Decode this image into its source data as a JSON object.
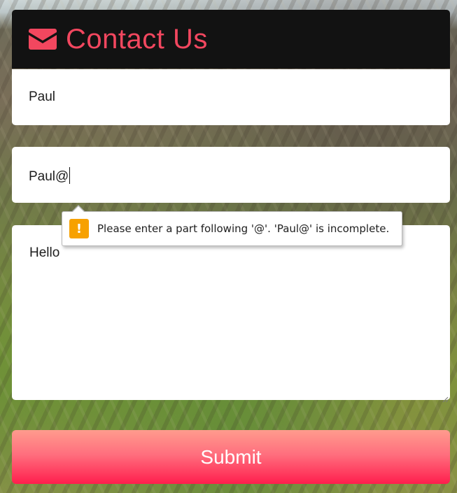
{
  "header": {
    "icon": "envelope-icon",
    "title": "Contact Us",
    "title_color": "#f2475f",
    "background": "#121212"
  },
  "form": {
    "name_value": "Paul",
    "email_value": "Paul@",
    "message_value": "Hello",
    "submit_label": "Submit"
  },
  "validation_tooltip": {
    "icon": "warning-icon",
    "icon_glyph": "!",
    "icon_color": "#f7a100",
    "message": "Please enter a part following '@'. 'Paul@' is incomplete."
  },
  "colors": {
    "submit_gradient_top": "#ff9b8d",
    "submit_gradient_bottom": "#ff1e4d"
  }
}
